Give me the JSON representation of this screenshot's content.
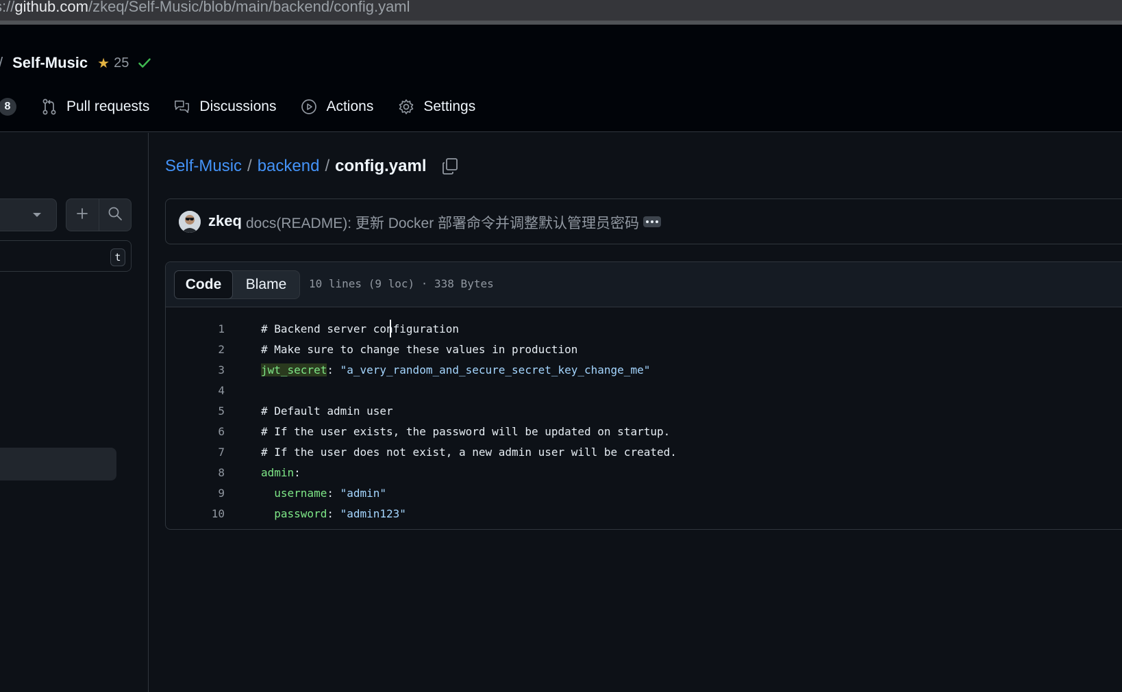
{
  "browser": {
    "url_prefix": "s://",
    "url_host": "github.com",
    "url_path": "/zkeq/Self-Music/blob/main/backend/config.yaml"
  },
  "header": {
    "slash": "/",
    "repo_name": "Self-Music",
    "star_icon": "★",
    "stars": "25",
    "nav_count": "8",
    "nav": [
      {
        "label": "Pull requests",
        "icon": "git-pull-request-icon"
      },
      {
        "label": "Discussions",
        "icon": "comment-discussion-icon"
      },
      {
        "label": "Actions",
        "icon": "play-icon"
      },
      {
        "label": "Settings",
        "icon": "gear-icon"
      }
    ]
  },
  "sidebar": {
    "add_icon": "+",
    "filter_shortcut": "t"
  },
  "breadcrumb": {
    "repo": "Self-Music",
    "folder": "backend",
    "file": "config.yaml",
    "sep": "/"
  },
  "commit": {
    "author": "zkeq",
    "message": "docs(README): 更新 Docker 部署命令并调整默认管理员密码"
  },
  "code_view": {
    "tabs": [
      "Code",
      "Blame"
    ],
    "active_tab": "Code",
    "file_info": "10 lines (9 loc) · 338 Bytes"
  },
  "code": {
    "lines": [
      {
        "n": "1",
        "text": "# Backend server configuration"
      },
      {
        "n": "2",
        "text": "# Make sure to change these values in production"
      },
      {
        "n": "3",
        "key": "jwt_secret",
        "sep": ": ",
        "value": "\"a_very_random_and_secure_secret_key_change_me\""
      },
      {
        "n": "4",
        "text": ""
      },
      {
        "n": "5",
        "text": "# Default admin user"
      },
      {
        "n": "6",
        "text": "# If the user exists, the password will be updated on startup."
      },
      {
        "n": "7",
        "text": "# If the user does not exist, a new admin user will be created."
      },
      {
        "n": "8",
        "key": "admin",
        "sep": ":"
      },
      {
        "n": "9",
        "indent": "  ",
        "key": "username",
        "sep": ": ",
        "value": "\"admin\""
      },
      {
        "n": "10",
        "indent": "  ",
        "key": "password",
        "sep": ": ",
        "value": "\"admin123\""
      }
    ]
  },
  "colors": {
    "bg": "#0d1117",
    "header_bg": "#010409",
    "link": "#4493f8",
    "yaml_key": "#7ee787",
    "yaml_string": "#a5d6ff",
    "comment": "#9198a1",
    "star": "#e3b341",
    "check": "#3fb950"
  }
}
